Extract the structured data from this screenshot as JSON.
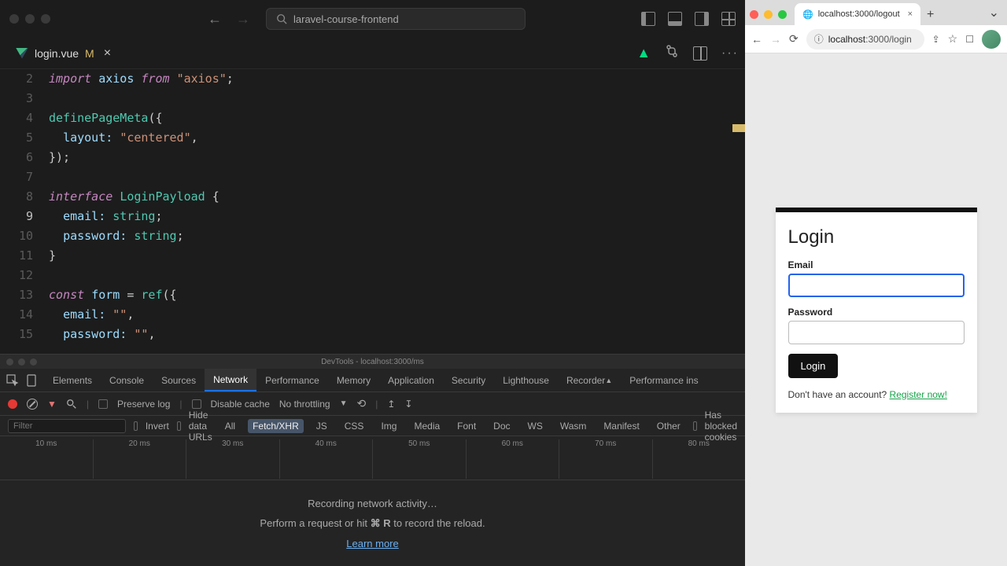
{
  "editor": {
    "project_name": "laravel-course-frontend",
    "tab": {
      "filename": "login.vue",
      "modified_marker": "M"
    },
    "lines": {
      "l2": "import axios from \"axios\";",
      "l4a": "definePageMeta",
      "l4b": "({",
      "l5a": "layout:",
      "l5b": "\"centered\"",
      "l5c": ",",
      "l6": "});",
      "l8a": "interface",
      "l8b": "LoginPayload",
      "l8c": "{",
      "l9a": "email:",
      "l9b": "string",
      "l9c": ";",
      "l10a": "password:",
      "l10b": "string",
      "l10c": ";",
      "l11": "}",
      "l13a": "const",
      "l13b": "form",
      "l13c": "=",
      "l13d": "ref",
      "l13e": "({",
      "l14a": "email:",
      "l14b": "\"\"",
      "l14c": ",",
      "l15a": "password:",
      "l15b": "\"\"",
      "l15c": ","
    },
    "line_numbers": [
      "2",
      "3",
      "4",
      "5",
      "6",
      "7",
      "8",
      "9",
      "10",
      "11",
      "12",
      "13",
      "14",
      "15"
    ]
  },
  "devtools": {
    "title": "DevTools - localhost:3000/ms",
    "tabs": [
      "Elements",
      "Console",
      "Sources",
      "Network",
      "Performance",
      "Memory",
      "Application",
      "Security",
      "Lighthouse",
      "Recorder",
      "Performance ins"
    ],
    "active_tab": "Network",
    "toolbar": {
      "preserve_log": "Preserve log",
      "disable_cache": "Disable cache",
      "throttling": "No throttling"
    },
    "filterbar": {
      "filter_placeholder": "Filter",
      "invert": "Invert",
      "hide_urls": "Hide data URLs",
      "types": [
        "All",
        "Fetch/XHR",
        "JS",
        "CSS",
        "Img",
        "Media",
        "Font",
        "Doc",
        "WS",
        "Wasm",
        "Manifest",
        "Other"
      ],
      "blocked": "Has blocked cookies"
    },
    "timeline_ticks": [
      "10 ms",
      "20 ms",
      "30 ms",
      "40 ms",
      "50 ms",
      "60 ms",
      "70 ms",
      "80 ms"
    ],
    "body": {
      "recording": "Recording network activity…",
      "hint_pre": "Perform a request or hit ",
      "hint_key": "⌘ R",
      "hint_post": " to record the reload.",
      "learn_more": "Learn more"
    }
  },
  "browser": {
    "tab_title": "localhost:3000/logout",
    "url_host": "localhost",
    "url_path": ":3000/login",
    "login": {
      "title": "Login",
      "email_label": "Email",
      "password_label": "Password",
      "button": "Login",
      "register_pre": "Don't have an account? ",
      "register_link": "Register now!"
    }
  }
}
